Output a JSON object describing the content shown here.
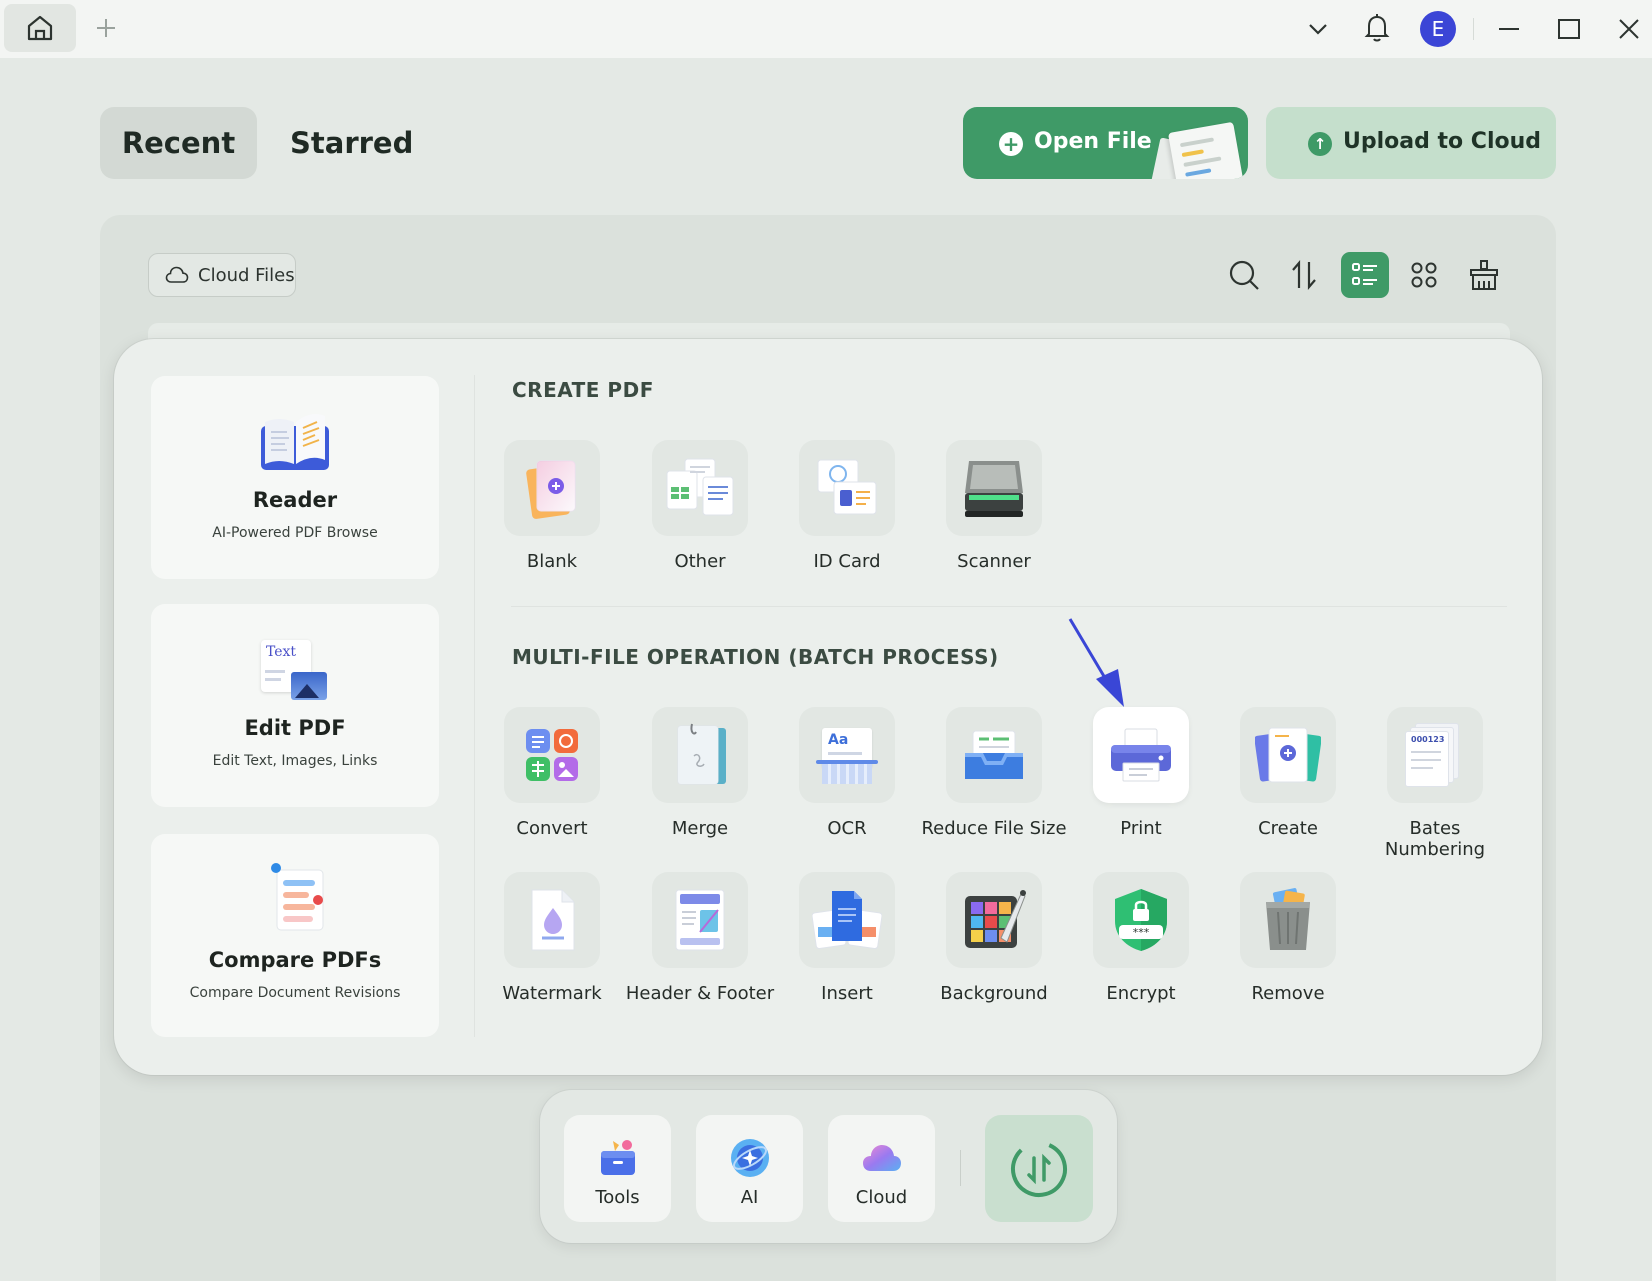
{
  "titlebar": {
    "avatar_letter": "E",
    "icons": [
      "home-icon",
      "plus-icon",
      "chevron-down-icon",
      "bell-icon",
      "minimize-icon",
      "maximize-icon",
      "close-icon"
    ]
  },
  "header": {
    "tab_recent": "Recent",
    "tab_starred": "Starred",
    "open_file": "Open File",
    "upload_to_cloud": "Upload to Cloud"
  },
  "toolbar": {
    "cloud_files": "Cloud Files",
    "icons": [
      "search-icon",
      "sort-icon",
      "list-view-icon",
      "grid-view-icon",
      "clean-icon"
    ],
    "active_view": "list"
  },
  "features": [
    {
      "title": "Reader",
      "subtitle": "AI-Powered PDF Browse"
    },
    {
      "title": "Edit PDF",
      "subtitle": "Edit Text, Images, Links",
      "icon_text": "Text"
    },
    {
      "title": "Compare PDFs",
      "subtitle": "Compare Document Revisions"
    }
  ],
  "create_pdf": {
    "title": "CREATE PDF",
    "items": [
      "Blank",
      "Other",
      "ID Card",
      "Scanner"
    ]
  },
  "multi_file": {
    "title": "MULTI-FILE OPERATION (BATCH PROCESS)",
    "row1": [
      "Convert",
      "Merge",
      "OCR",
      "Reduce File Size",
      "Print",
      "Create",
      "Bates Numbering"
    ],
    "row2": [
      "Watermark",
      "Header & Footer",
      "Insert",
      "Background",
      "Encrypt",
      "Remove"
    ],
    "ocr_icon_text": "Aa",
    "bates_icon_text": "000123",
    "highlighted": "Print"
  },
  "dock": {
    "items": [
      "Tools",
      "AI",
      "Cloud"
    ]
  },
  "colors": {
    "brand_green": "#3f9a67",
    "annotation_arrow": "#3a46d6",
    "avatar": "#3b45d6"
  }
}
